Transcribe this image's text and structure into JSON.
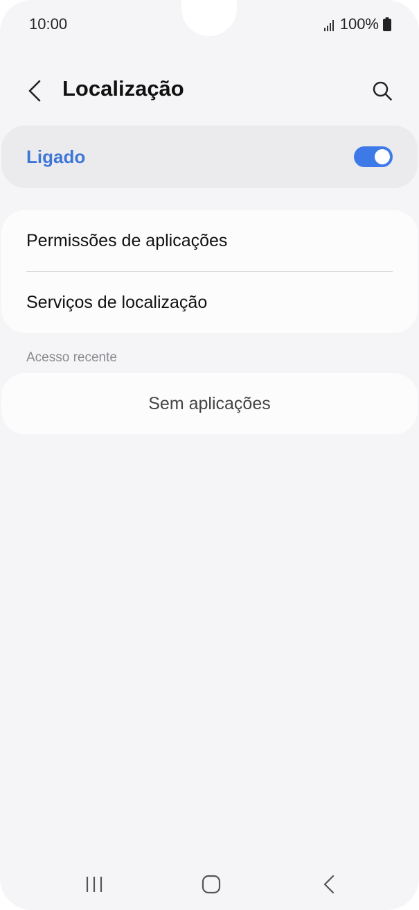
{
  "status_bar": {
    "time": "10:00",
    "battery": "100%"
  },
  "header": {
    "title": "Localização"
  },
  "master_toggle": {
    "label": "Ligado",
    "state": "on",
    "accent_color": "#3e76d6"
  },
  "settings": {
    "items": [
      {
        "label": "Permissões de aplicações"
      },
      {
        "label": "Serviços de localização"
      }
    ]
  },
  "recent_access": {
    "header": "Acesso recente",
    "empty_text": "Sem aplicações"
  },
  "icons": {
    "back": "chevron-left-icon",
    "search": "search-icon",
    "nav_recents": "recents-icon",
    "nav_home": "home-icon",
    "nav_back": "back-icon"
  }
}
